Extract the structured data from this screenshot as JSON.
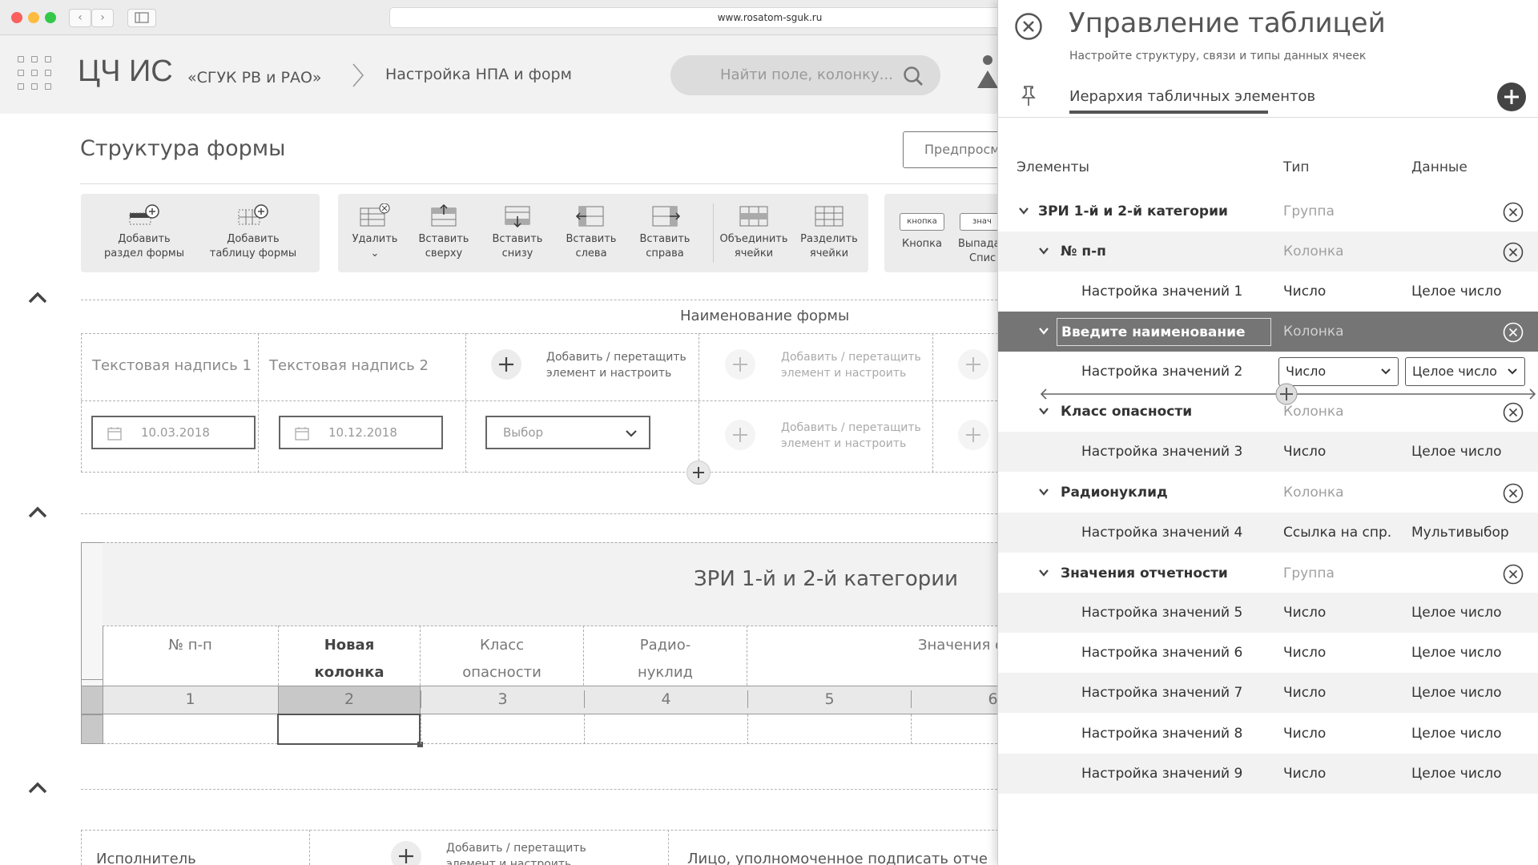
{
  "browser": {
    "url": "www.rosatom-sguk.ru"
  },
  "app": {
    "logo": "ЦЧ ИС",
    "org": "«СГУК РВ и РАО»",
    "breadcrumb": "Настройка НПА и форм",
    "search_placeholder": "Найти поле, колонку..."
  },
  "page": {
    "title": "Структура формы",
    "preview_button": "Предпросм"
  },
  "toolbar": {
    "group1": [
      {
        "label1": "Добавить",
        "label2": "раздел формы"
      },
      {
        "label1": "Добавить",
        "label2": "таблицу формы"
      }
    ],
    "group2": [
      {
        "label1": "Удалить",
        "label2": "⌄"
      },
      {
        "label1": "Вставить",
        "label2": "сверху"
      },
      {
        "label1": "Вставить",
        "label2": "снизу"
      },
      {
        "label1": "Вставить",
        "label2": "слева"
      },
      {
        "label1": "Вставить",
        "label2": "справа"
      },
      {
        "label1": "Объединить",
        "label2": "ячейки"
      },
      {
        "label1": "Разделить",
        "label2": "ячейки"
      }
    ],
    "group3": [
      {
        "chip": "кнопка",
        "label1": "Кнопка",
        "label2": ""
      },
      {
        "chip": "знач",
        "label1": "Выпада",
        "label2": "Спис"
      }
    ]
  },
  "form": {
    "name": "Наименование формы",
    "text1": "Текстовая надпись 1",
    "text2": "Текстовая надпись 2",
    "add_line1": "Добавить / перетащить",
    "add_line2": "элемент и настроить",
    "date1": "10.03.2018",
    "date2": "10.12.2018",
    "select": "Выбор"
  },
  "table": {
    "title": "ЗРИ 1-й и 2-й категории",
    "headers": [
      {
        "l1": "№ п-п",
        "l2": ""
      },
      {
        "l1": "Новая",
        "l2": "колонка"
      },
      {
        "l1": "Класс",
        "l2": "опасности"
      },
      {
        "l1": "Радио-",
        "l2": "нуклид"
      },
      {
        "l1": "Значения о",
        "l2": ""
      }
    ],
    "numbers": [
      "1",
      "2",
      "3",
      "4",
      "5",
      "6"
    ]
  },
  "section3": {
    "executor": "Исполнитель",
    "authorized": "Лицо, уполномоченное подписать отче"
  },
  "panel": {
    "title": "Управление таблицей",
    "subtitle": "Настройте структуру, связи и типы данных ячеек",
    "tab": "Иерархия табличных элементов",
    "col_elements": "Элементы",
    "col_type": "Тип",
    "col_data": "Данные",
    "rows": [
      {
        "name": "ЗРИ 1-й и 2-й категории",
        "type": "Группа",
        "data": ""
      },
      {
        "name": "№ п-п",
        "type": "Колонка",
        "data": ""
      },
      {
        "name": "Настройка значений 1",
        "type": "Число",
        "data": "Целое число"
      },
      {
        "name": "Введите наименование",
        "type": "Колонка",
        "data": ""
      },
      {
        "name": "Настройка значений 2",
        "type": "Число",
        "data": "Целое число"
      },
      {
        "name": "Класс опасности",
        "type": "Колонка",
        "data": ""
      },
      {
        "name": "Настройка значений 3",
        "type": "Число",
        "data": "Целое число"
      },
      {
        "name": "Радионуклид",
        "type": "Колонка",
        "data": ""
      },
      {
        "name": "Настройка значений 4",
        "type": "Ссылка на спр.",
        "data": "Мультивыбор"
      },
      {
        "name": "Значения отчетности",
        "type": "Группа",
        "data": ""
      },
      {
        "name": "Настройка значений 5",
        "type": "Число",
        "data": "Целое число"
      },
      {
        "name": "Настройка значений 6",
        "type": "Число",
        "data": "Целое число"
      },
      {
        "name": "Настройка значений 7",
        "type": "Число",
        "data": "Целое число"
      },
      {
        "name": "Настройка значений 8",
        "type": "Число",
        "data": "Целое число"
      },
      {
        "name": "Настройка значений 9",
        "type": "Число",
        "data": "Целое число"
      }
    ]
  }
}
